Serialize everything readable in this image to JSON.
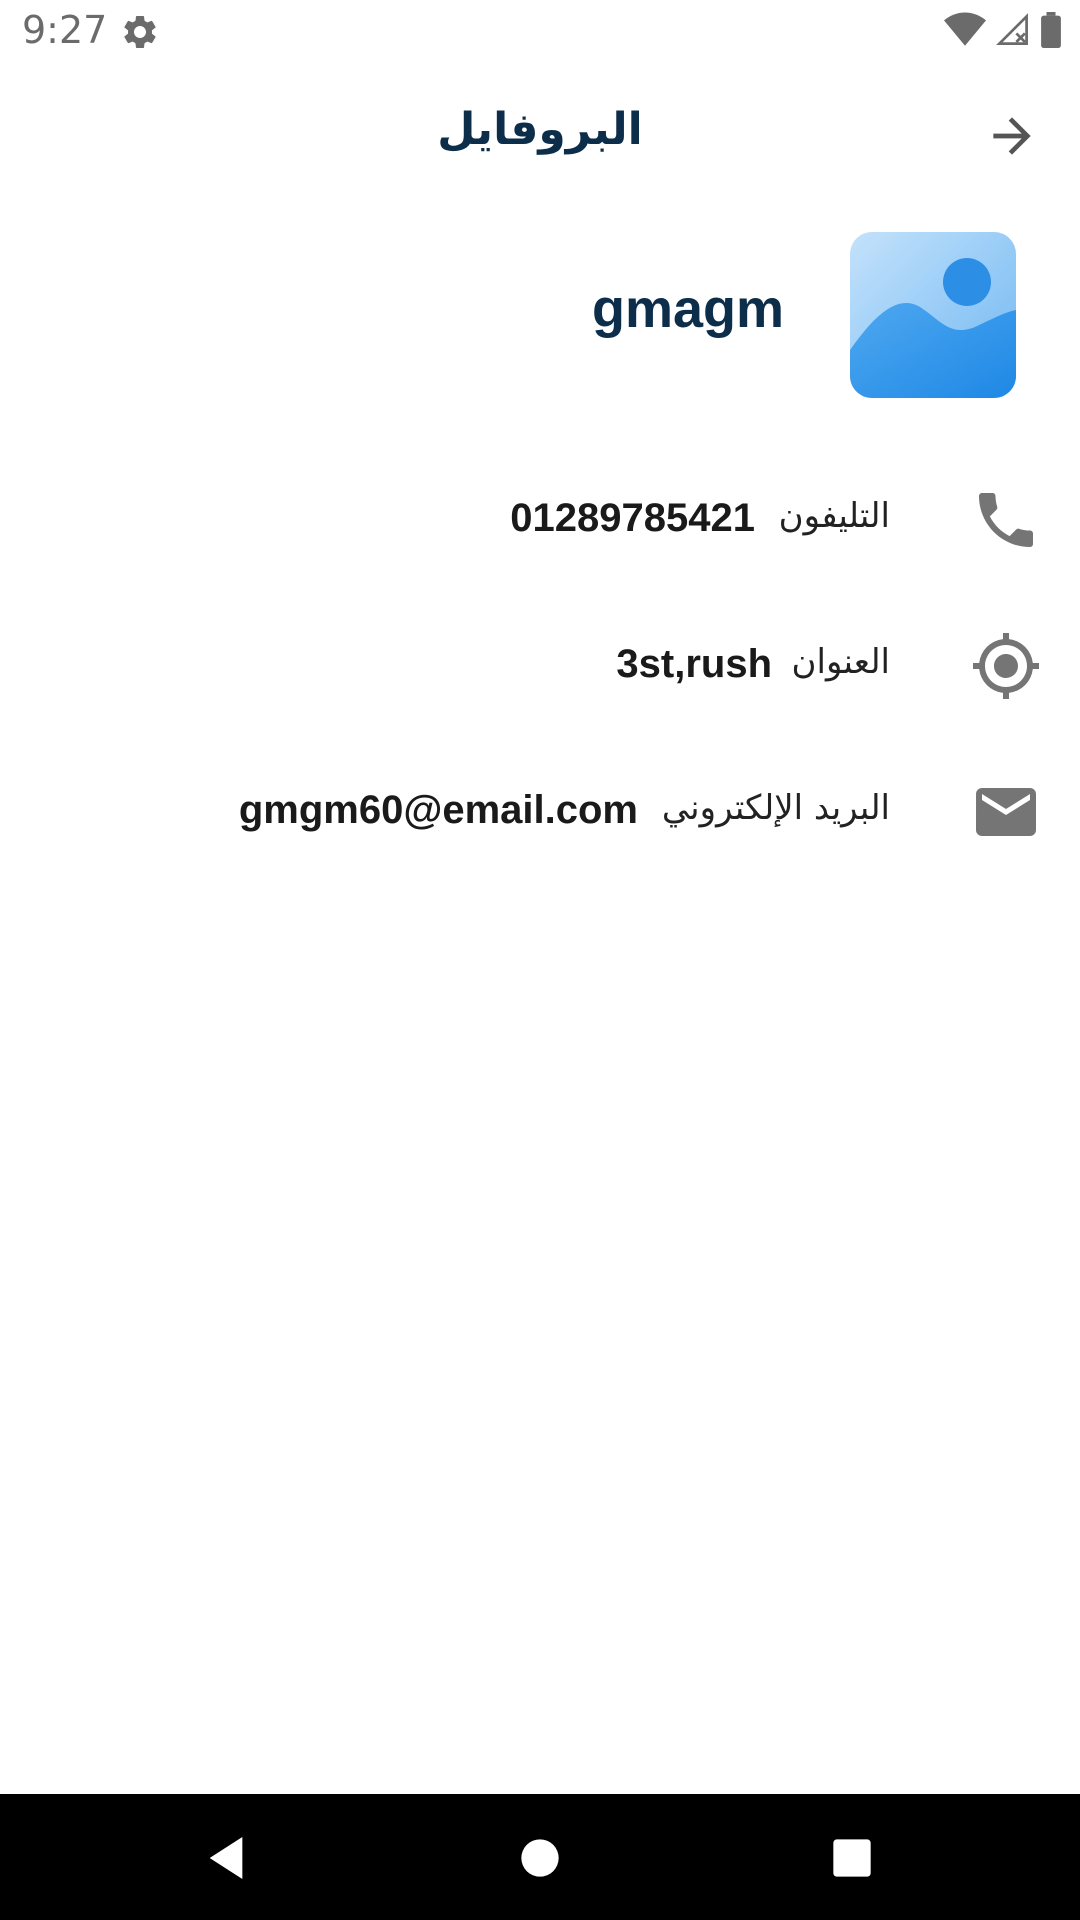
{
  "status_bar": {
    "time": "9:27",
    "icons": [
      "gear-icon",
      "wifi-icon",
      "signal-icon",
      "battery-icon"
    ]
  },
  "app_bar": {
    "title": "البروفايل",
    "back_icon": "arrow-right-icon"
  },
  "profile": {
    "username": "gmagm",
    "avatar_icon": "image-placeholder-icon"
  },
  "info": {
    "phone": {
      "label": "التليفون",
      "value": "01289785421",
      "icon": "phone-icon"
    },
    "address": {
      "label": "العنوان",
      "value": "3st,rush",
      "icon": "location-target-icon"
    },
    "email": {
      "label": "البريد الإلكتروني",
      "value": "gmgm60@email.com",
      "icon": "mail-icon"
    }
  },
  "nav_bar": {
    "buttons": [
      "back-icon",
      "home-icon",
      "recents-icon"
    ]
  },
  "colors": {
    "title": "#0d2e4a",
    "icon_gray": "#757575",
    "avatar_light": "#bbdefb",
    "avatar_dark": "#1e88e5"
  }
}
